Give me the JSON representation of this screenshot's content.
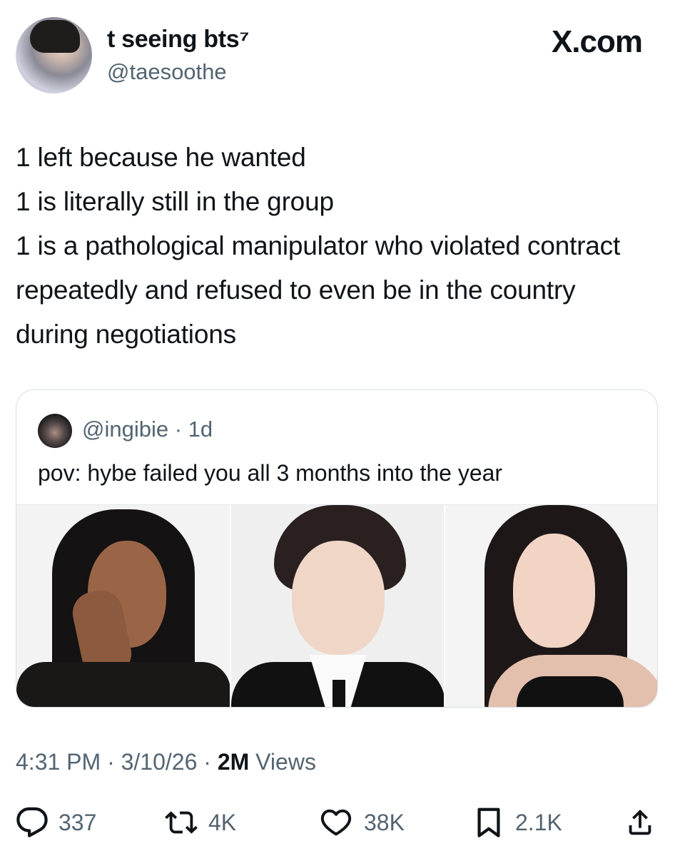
{
  "author": {
    "display_name": "t seeing bts⁷",
    "handle": "@taesoothe"
  },
  "source": "X.com",
  "tweet": {
    "text": "1 left because he wanted\n1 is literally still in the group\n1 is a pathological manipulator who violated contract repeatedly and refused to even be in the country during negotiations"
  },
  "quoted_tweet": {
    "handle": "@ingibie",
    "separator": "·",
    "age": "1d",
    "text": "pov: hybe failed you all 3 months into the year"
  },
  "meta": {
    "time": "4:31 PM",
    "date": "3/10/26",
    "views_count": "2M",
    "views_label": "Views",
    "separator": "·"
  },
  "actions": {
    "replies": "337",
    "reposts": "4K",
    "likes": "38K",
    "bookmarks": "2.1K"
  },
  "colors": {
    "text": "#0f1419",
    "secondary": "#536471",
    "border": "#d8dee4"
  }
}
